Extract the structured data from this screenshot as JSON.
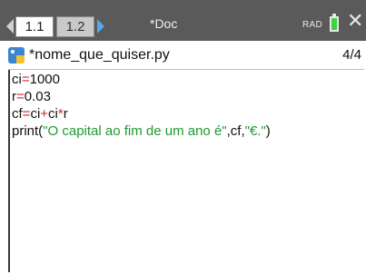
{
  "top_bar": {
    "tabs": [
      {
        "label": "1.1",
        "active": true
      },
      {
        "label": "1.2",
        "active": false
      }
    ],
    "document_title": "*Doc",
    "angle_mode": "RAD",
    "battery_color": "#3fd23f",
    "icons": [
      "chevron-left-icon",
      "chevron-right-icon",
      "battery-icon",
      "close-icon"
    ]
  },
  "file_header": {
    "icon": "python-icon",
    "filename": "*nome_que_quiser.py",
    "page": "4/4"
  },
  "code": {
    "line1": {
      "var": "ci",
      "op": "=",
      "val": "1000"
    },
    "line2": {
      "var": "r",
      "op": "=",
      "val": "0.03"
    },
    "line3": {
      "var": "cf",
      "op1": "=",
      "a": "ci",
      "op2": "+",
      "b": "ci",
      "op3": "*",
      "c": "r"
    },
    "line4": {
      "fn": "print(",
      "str1": "\"O capital ao fim de um ano é\"",
      "sep1": ",cf,",
      "str2": "\"€.\"",
      "close": ")"
    }
  },
  "colors": {
    "operator": "#d2262a",
    "string": "#1f9a2f",
    "accent_blue": "#5aa7e6"
  }
}
